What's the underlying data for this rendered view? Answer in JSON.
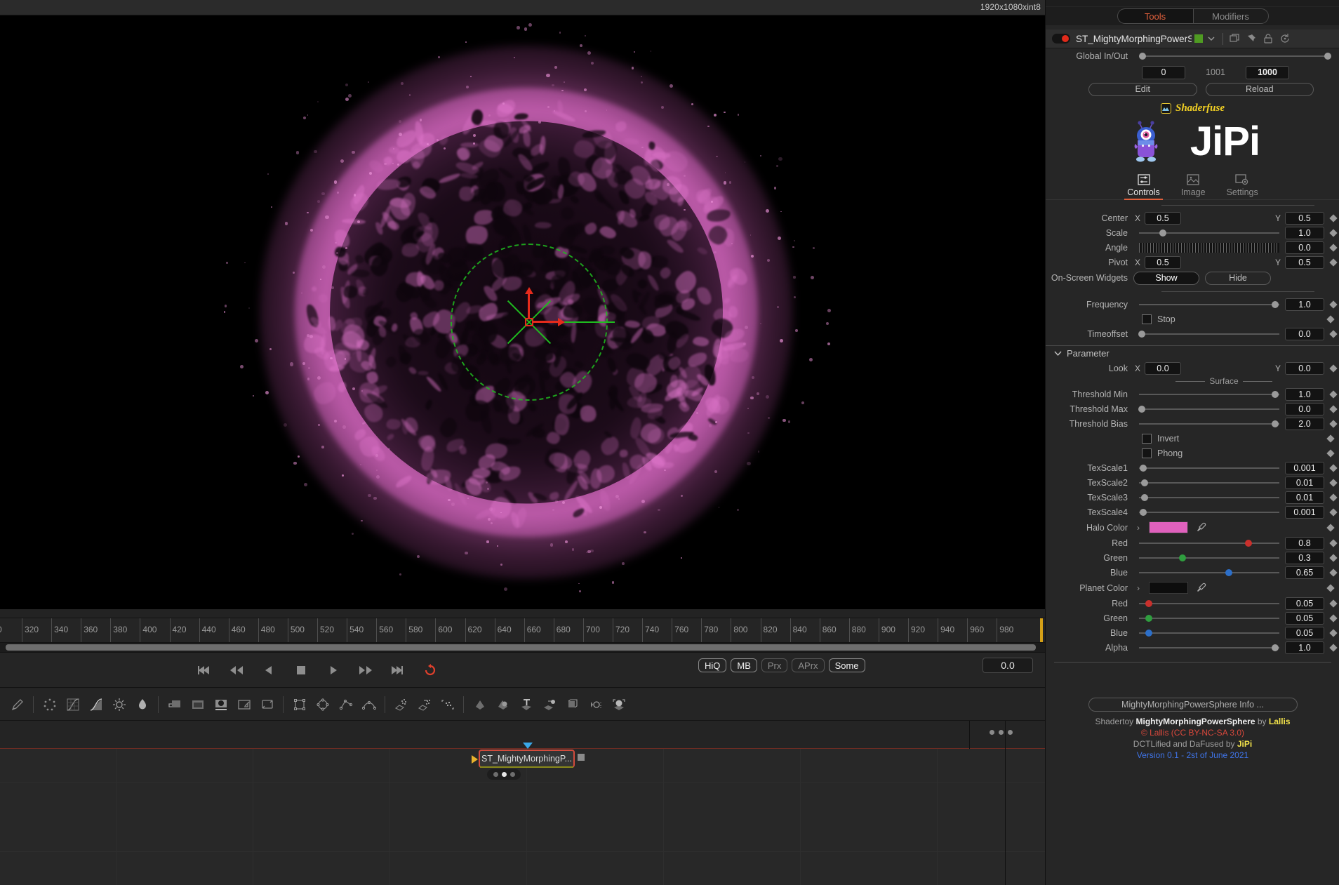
{
  "viewer": {
    "resolution_label": "1920x1080xint8"
  },
  "timeline": {
    "ticks": [
      320,
      340,
      360,
      380,
      400,
      420,
      440,
      460,
      480,
      500,
      520,
      540,
      560,
      580,
      600,
      620,
      640,
      660,
      680,
      700,
      720,
      740,
      760,
      780,
      800,
      820,
      840,
      860,
      880,
      900,
      920,
      940,
      960,
      980
    ],
    "first_partial_label": "0"
  },
  "transport": {
    "buttons": [
      {
        "name": "skip-to-start-button",
        "icon": "skip-back-icon"
      },
      {
        "name": "rewind-button",
        "icon": "rewind-icon"
      },
      {
        "name": "play-reverse-button",
        "icon": "play-reverse-icon"
      },
      {
        "name": "stop-button",
        "icon": "stop-icon"
      },
      {
        "name": "play-button",
        "icon": "play-icon"
      },
      {
        "name": "fast-forward-button",
        "icon": "fast-forward-icon"
      },
      {
        "name": "skip-to-end-button",
        "icon": "skip-forward-icon"
      },
      {
        "name": "loop-button",
        "icon": "loop-icon"
      }
    ],
    "quality_buttons": [
      {
        "label": "HiQ",
        "on": true
      },
      {
        "label": "MB",
        "on": true
      },
      {
        "label": "Prx",
        "on": false
      },
      {
        "label": "APrx",
        "on": false
      },
      {
        "label": "Some",
        "on": true
      }
    ],
    "current_time": "0.0"
  },
  "node": {
    "label": "ST_MightyMorphingP..."
  },
  "inspector": {
    "pills": [
      {
        "label": "Tools",
        "active": true
      },
      {
        "label": "Modifiers",
        "active": false
      }
    ],
    "tool_name": "ST_MightyMorphingPowerSphe",
    "tool_color": "#4f9b22",
    "header_icons": [
      "copy-icon",
      "pin-icon",
      "lock-icon",
      "reset-icon"
    ],
    "global_inout": {
      "label": "Global In/Out",
      "in_value": "0",
      "mid_value": "1001",
      "out_value": "1000"
    },
    "edit_button": "Edit",
    "reload_button": "Reload",
    "shaderfuse_label": "Shaderfuse",
    "brand_label": "JiPi",
    "nav_tabs": [
      {
        "label": "Controls",
        "icon": "sliders-icon",
        "active": true
      },
      {
        "label": "Image",
        "icon": "image-icon",
        "active": false
      },
      {
        "label": "Settings",
        "icon": "image-settings-icon",
        "active": false
      }
    ],
    "controls": {
      "center": {
        "label": "Center",
        "x_label": "X",
        "x": "0.5",
        "y_label": "Y",
        "y": "0.5"
      },
      "scale": {
        "label": "Scale",
        "value": "1.0",
        "knob_pct": 17
      },
      "angle": {
        "label": "Angle",
        "value": "0.0"
      },
      "pivot": {
        "label": "Pivot",
        "x_label": "X",
        "x": "0.5",
        "y_label": "Y",
        "y": "0.5"
      },
      "onscreen_widgets": {
        "label": "On-Screen Widgets",
        "show": "Show",
        "hide": "Hide",
        "active": "Show"
      },
      "frequency": {
        "label": "Frequency",
        "value": "1.0",
        "knob_pct": 97
      },
      "stop": {
        "label": "Stop",
        "checked": false
      },
      "timeoffset": {
        "label": "Timeoffset",
        "value": "0.0",
        "knob_pct": 2
      }
    },
    "parameter_section": {
      "label": "Parameter",
      "look": {
        "label": "Look",
        "x_label": "X",
        "x": "0.0",
        "y_label": "Y",
        "y": "0.0"
      },
      "surface_label": "Surface",
      "threshold_min": {
        "label": "Threshold Min",
        "value": "1.0",
        "knob_pct": 97
      },
      "threshold_max": {
        "label": "Threshold Max",
        "value": "0.0",
        "knob_pct": 2
      },
      "threshold_bias": {
        "label": "Threshold Bias",
        "value": "2.0",
        "knob_pct": 97
      },
      "invert": {
        "label": "Invert",
        "checked": false
      },
      "phong": {
        "label": "Phong",
        "checked": false
      },
      "texscale1": {
        "label": "TexScale1",
        "value": "0.001",
        "knob_pct": 3
      },
      "texscale2": {
        "label": "TexScale2",
        "value": "0.01",
        "knob_pct": 4
      },
      "texscale3": {
        "label": "TexScale3",
        "value": "0.01",
        "knob_pct": 4
      },
      "texscale4": {
        "label": "TexScale4",
        "value": "0.001",
        "knob_pct": 3
      },
      "halo_color": {
        "label": "Halo Color",
        "swatch": "#e061bd"
      },
      "halo_red": {
        "label": "Red",
        "value": "0.8",
        "knob_pct": 78
      },
      "halo_green": {
        "label": "Green",
        "value": "0.3",
        "knob_pct": 31
      },
      "halo_blue": {
        "label": "Blue",
        "value": "0.65",
        "knob_pct": 64
      },
      "planet_color": {
        "label": "Planet Color",
        "swatch": "#0d0d0d"
      },
      "planet_red": {
        "label": "Red",
        "value": "0.05",
        "knob_pct": 7
      },
      "planet_green": {
        "label": "Green",
        "value": "0.05",
        "knob_pct": 7
      },
      "planet_blue": {
        "label": "Blue",
        "value": "0.05",
        "knob_pct": 7
      },
      "alpha": {
        "label": "Alpha",
        "value": "1.0",
        "knob_pct": 97
      }
    },
    "info_button": "MightyMorphingPowerSphere Info ...",
    "credits": {
      "line1_a": "Shadertoy ",
      "line1_b": "MightyMorphingPowerSphere",
      "line1_c": " by ",
      "line1_d": "Lallis",
      "line2": "© Lallis (CC BY-NC-SA 3.0)",
      "line3_a": "DCTLified and DaFused by ",
      "line3_b": "JiPi",
      "line4": "Version 0.1 - 2st of June 2021"
    }
  }
}
